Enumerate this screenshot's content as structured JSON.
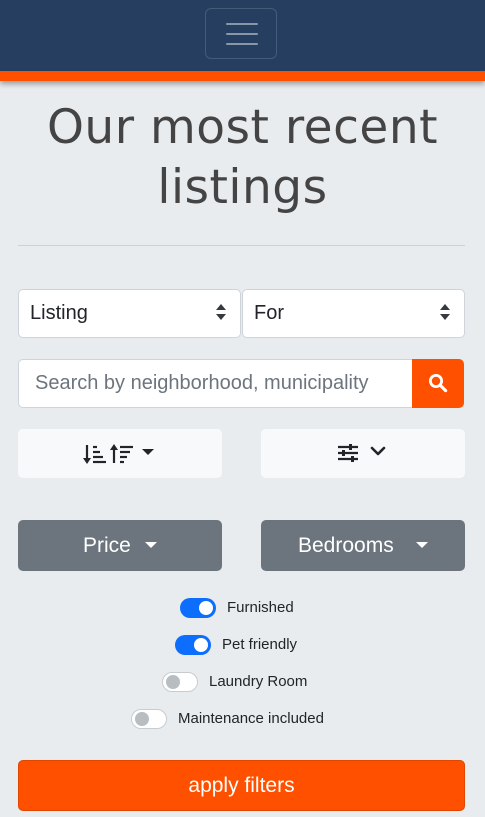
{
  "header": {
    "menu_icon": "hamburger-menu-icon",
    "colors": {
      "navbar": "#263f61",
      "accent": "#ff5000"
    }
  },
  "page": {
    "title_line1": "Our most recent",
    "title_line2": "listings"
  },
  "filters": {
    "listing_select": {
      "selected": "Listing"
    },
    "for_select": {
      "selected": "For"
    },
    "search": {
      "placeholder": "Search by neighborhood, municipality",
      "button_icon": "search-icon"
    },
    "sort_button": {
      "icons": [
        "sort-amount-down-icon",
        "sort-amount-up-icon",
        "caret-down-icon"
      ]
    },
    "more_filters_button": {
      "icons": [
        "sliders-icon",
        "chevron-down-icon"
      ]
    },
    "price_label": "Price",
    "bedrooms_label": "Bedrooms",
    "toggles": [
      {
        "label": "Furnished",
        "checked": true
      },
      {
        "label": "Pet friendly",
        "checked": true
      },
      {
        "label": "Laundry Room",
        "checked": false
      },
      {
        "label": "Maintenance included",
        "checked": false
      }
    ],
    "apply_label": "apply filters"
  }
}
